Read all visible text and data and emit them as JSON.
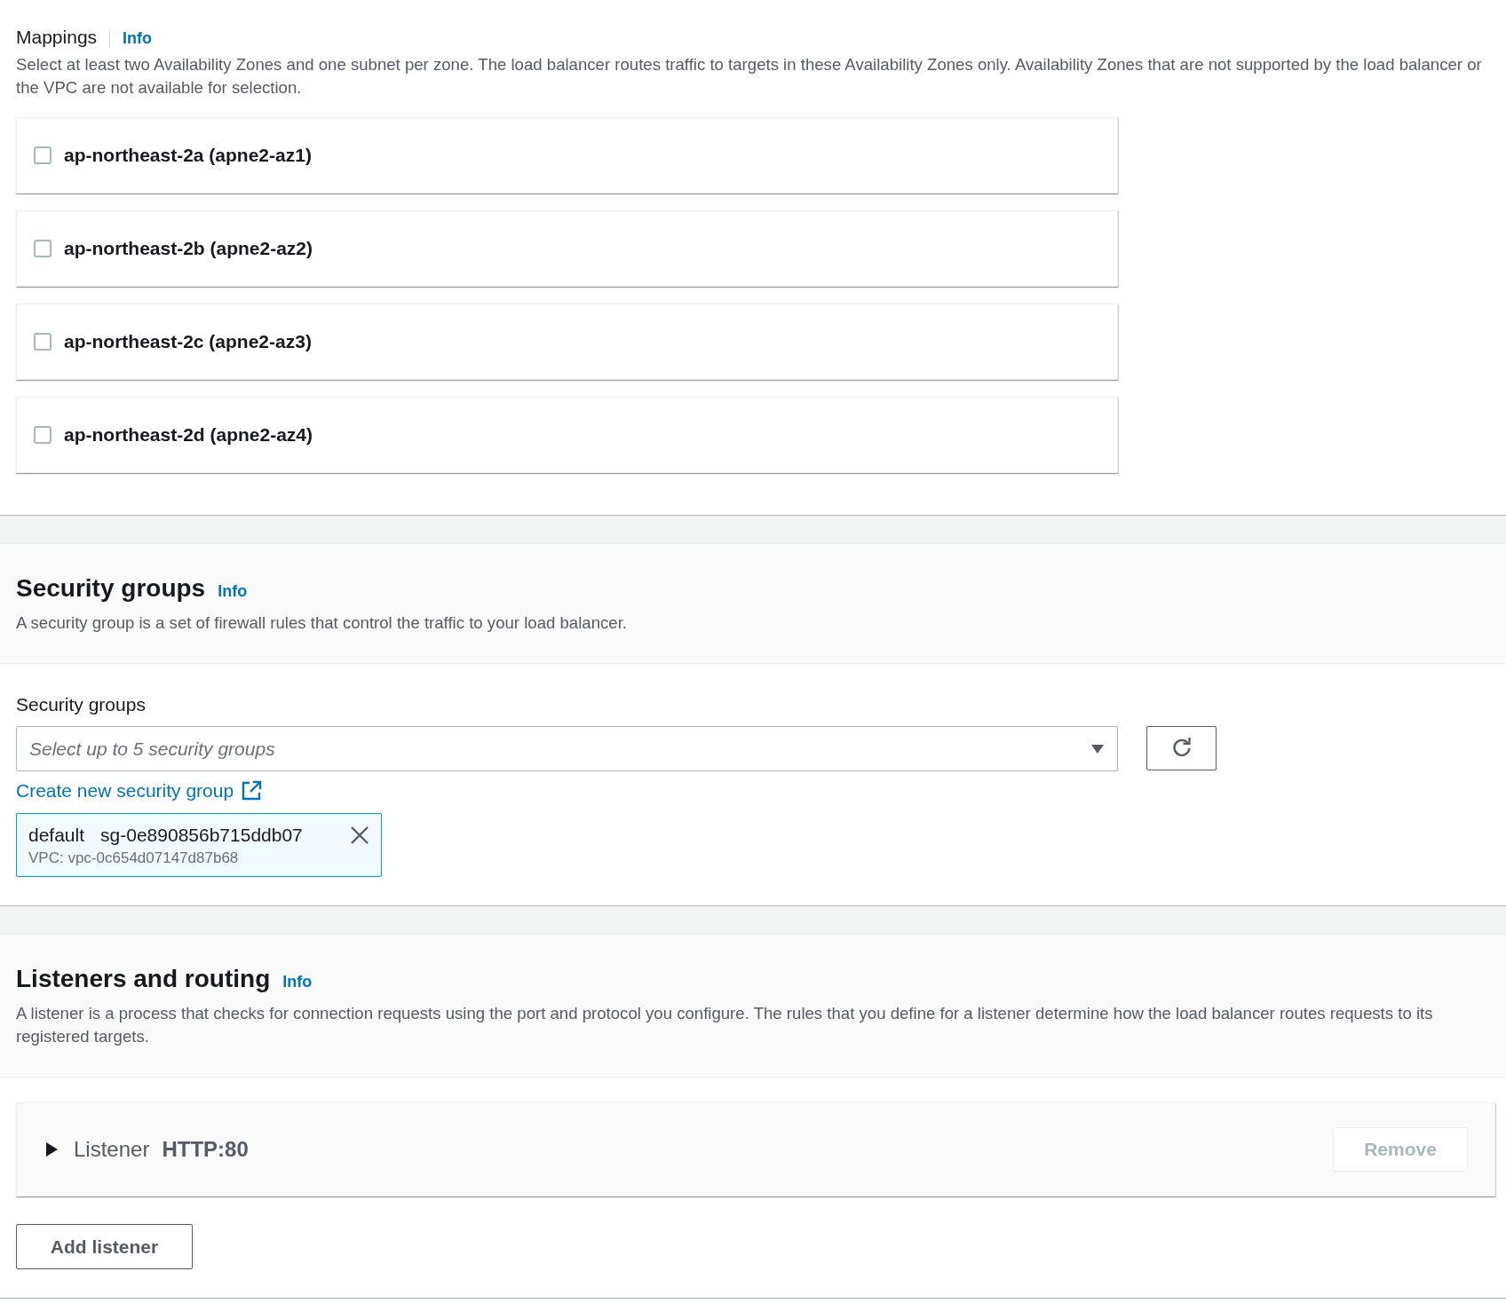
{
  "mappings": {
    "title": "Mappings",
    "info": "Info",
    "description": "Select at least two Availability Zones and one subnet per zone. The load balancer routes traffic to targets in these Availability Zones only. Availability Zones that are not supported by the load balancer or the VPC are not available for selection.",
    "zones": [
      {
        "label": "ap-northeast-2a (apne2-az1)",
        "checked": false
      },
      {
        "label": "ap-northeast-2b (apne2-az2)",
        "checked": false
      },
      {
        "label": "ap-northeast-2c (apne2-az3)",
        "checked": false
      },
      {
        "label": "ap-northeast-2d (apne2-az4)",
        "checked": false
      }
    ]
  },
  "security_groups": {
    "title": "Security groups",
    "info": "Info",
    "description": "A security group is a set of firewall rules that control the traffic to your load balancer.",
    "field_label": "Security groups",
    "select": {
      "placeholder": "Select up to 5 security groups"
    },
    "create_link": "Create new security group",
    "tokens": [
      {
        "name": "default",
        "id": "sg-0e890856b715ddb07",
        "vpc": "VPC: vpc-0c654d07147d87b68"
      }
    ]
  },
  "listeners": {
    "title": "Listeners and routing",
    "info": "Info",
    "description": "A listener is a process that checks for connection requests using the port and protocol you configure. The rules that you define for a listener determine how the load balancer routes requests to its registered targets.",
    "items": [
      {
        "label": "Listener",
        "value": "HTTP:80",
        "expanded": false,
        "remove": {
          "label": "Remove",
          "disabled": true
        }
      }
    ],
    "add_button": "Add listener"
  }
}
